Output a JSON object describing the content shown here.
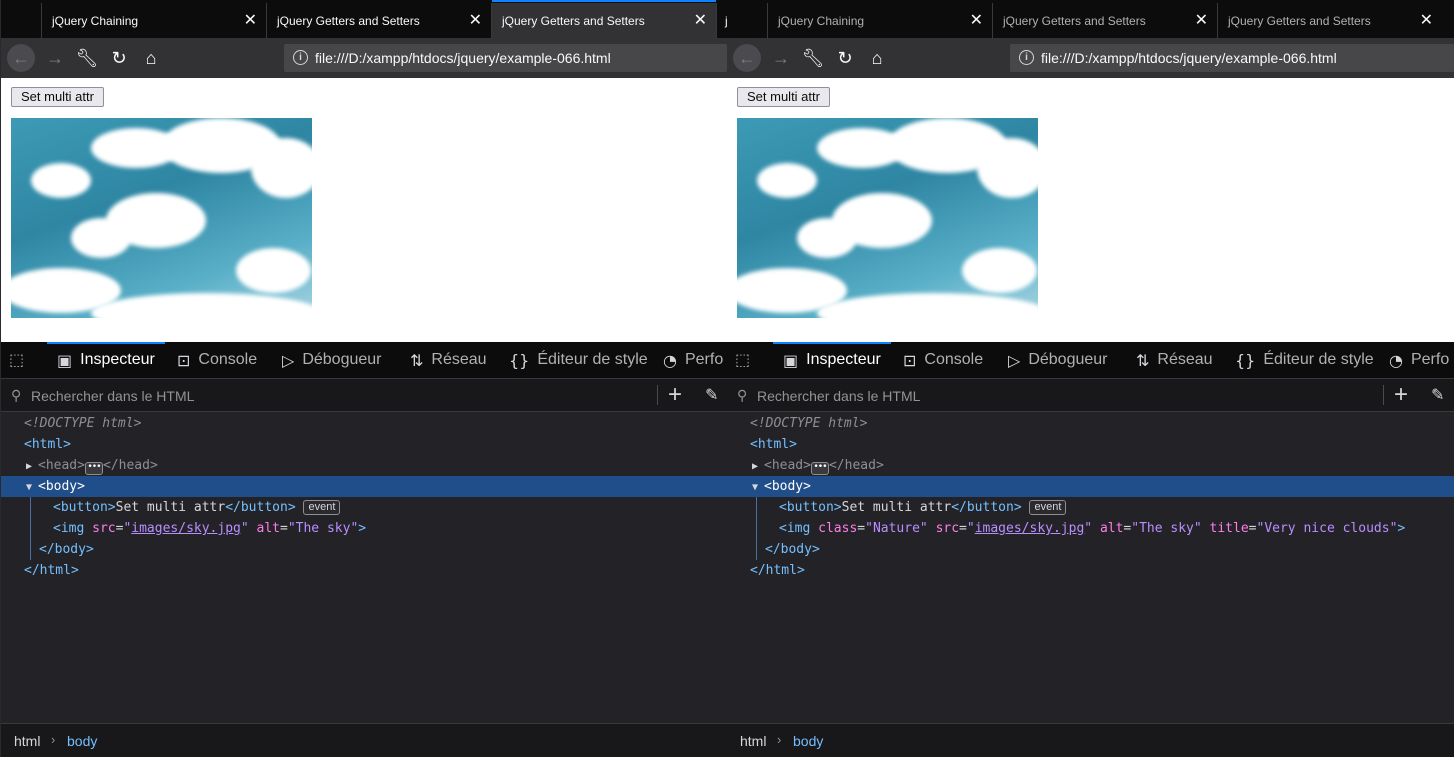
{
  "left": {
    "tabs": [
      "jQuery Chaining",
      "jQuery Getters and Setters",
      "jQuery Getters and Setters"
    ],
    "tab_edge": "j",
    "url": "file:///D:/xampp/htdocs/jquery/example-066.html",
    "page_button": "Set multi attr",
    "devtools": {
      "tabs": [
        "Inspecteur",
        "Console",
        "Débogueur",
        "Réseau",
        "Éditeur de style",
        "Perfo"
      ],
      "search_placeholder": "Rechercher dans le HTML",
      "lines": {
        "doctype": "<!DOCTYPE html>",
        "html_open": "html",
        "head_open": "head",
        "head_close": "head",
        "body_open": "body",
        "button_open": "button",
        "button_text": "Set multi attr",
        "button_close": "button",
        "event_badge": "event",
        "img_tag": "img",
        "img_src_name": "src",
        "img_src_value": "images/sky.jpg",
        "img_alt_name": "alt",
        "img_alt_value": "The sky",
        "body_close": "body",
        "html_close": "html"
      },
      "breadcrumbs": [
        "html",
        "body"
      ]
    }
  },
  "right": {
    "tabs": [
      "jQuery Chaining",
      "jQuery Getters and Setters",
      "jQuery Getters and Setters"
    ],
    "url": "file:///D:/xampp/htdocs/jquery/example-066.html",
    "page_button": "Set multi attr",
    "devtools": {
      "tabs": [
        "Inspecteur",
        "Console",
        "Débogueur",
        "Réseau",
        "Éditeur de style",
        "Perfo"
      ],
      "search_placeholder": "Rechercher dans le HTML",
      "lines": {
        "doctype": "<!DOCTYPE html>",
        "html_open": "html",
        "head_open": "head",
        "head_close": "head",
        "body_open": "body",
        "button_open": "button",
        "button_text": "Set multi attr",
        "button_close": "button",
        "event_badge": "event",
        "img_tag": "img",
        "img_class_name": "class",
        "img_class_value": "Nature",
        "img_src_name": "src",
        "img_src_value": "images/sky.jpg",
        "img_alt_name": "alt",
        "img_alt_value": "The sky",
        "img_title_name": "title",
        "img_title_value": "Very nice clouds",
        "body_close": "body",
        "html_close": "html"
      },
      "breadcrumbs": [
        "html",
        "body"
      ]
    }
  },
  "colors": {
    "accent": "#0a84ff",
    "selection": "#204e8a",
    "tag": "#75bfff",
    "attr_name": "#ff7de9",
    "attr_value": "#b98eff"
  },
  "icons": [
    "back-arrow-icon",
    "forward-arrow-icon",
    "wrench-icon",
    "reload-icon",
    "home-icon",
    "info-icon",
    "close-icon",
    "element-picker-icon",
    "inspector-icon",
    "console-icon",
    "debugger-icon",
    "network-icon",
    "style-editor-icon",
    "performance-icon",
    "search-icon",
    "plus-icon",
    "eyedropper-icon",
    "chevron-right-icon"
  ]
}
